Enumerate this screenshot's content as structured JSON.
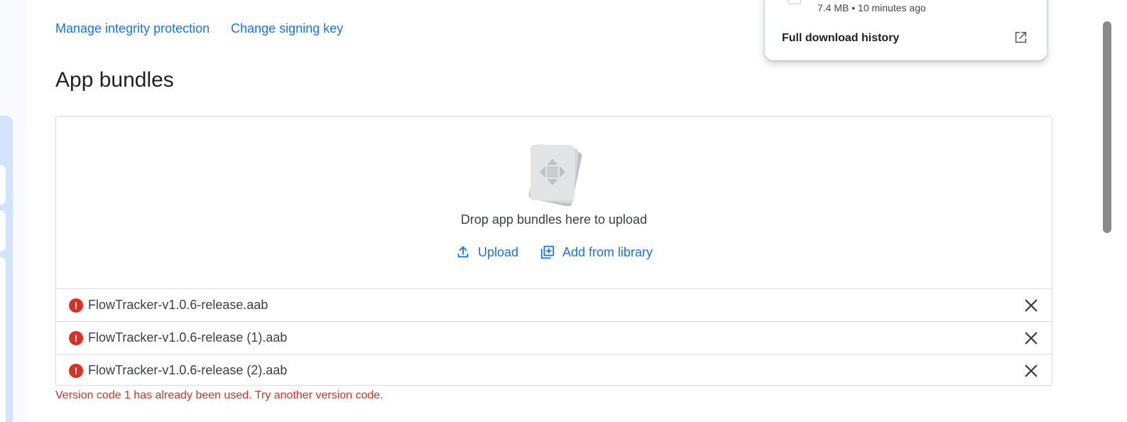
{
  "top_links": {
    "manage_integrity": "Manage integrity protection",
    "change_signing_key": "Change signing key"
  },
  "section": {
    "title": "App bundles"
  },
  "dropzone": {
    "text": "Drop app bundles here to upload",
    "upload_label": "Upload",
    "add_from_library_label": "Add from library"
  },
  "files": [
    {
      "name": "FlowTracker-v1.0.6-release.aab",
      "status_icon": "error-icon"
    },
    {
      "name": "FlowTracker-v1.0.6-release (1).aab",
      "status_icon": "error-icon"
    },
    {
      "name": "FlowTracker-v1.0.6-release (2).aab",
      "status_icon": "error-icon"
    }
  ],
  "error_message": "Version code 1 has already been used. Try another version code.",
  "download_panel": {
    "file_meta": "7.4 MB • 10 minutes ago",
    "history_label": "Full download history",
    "open_icon": "open-in-new-icon"
  },
  "colors": {
    "link": "#1a73e8",
    "error": "#d93025",
    "border": "#dadce0",
    "rail": "#d3e3fd"
  }
}
